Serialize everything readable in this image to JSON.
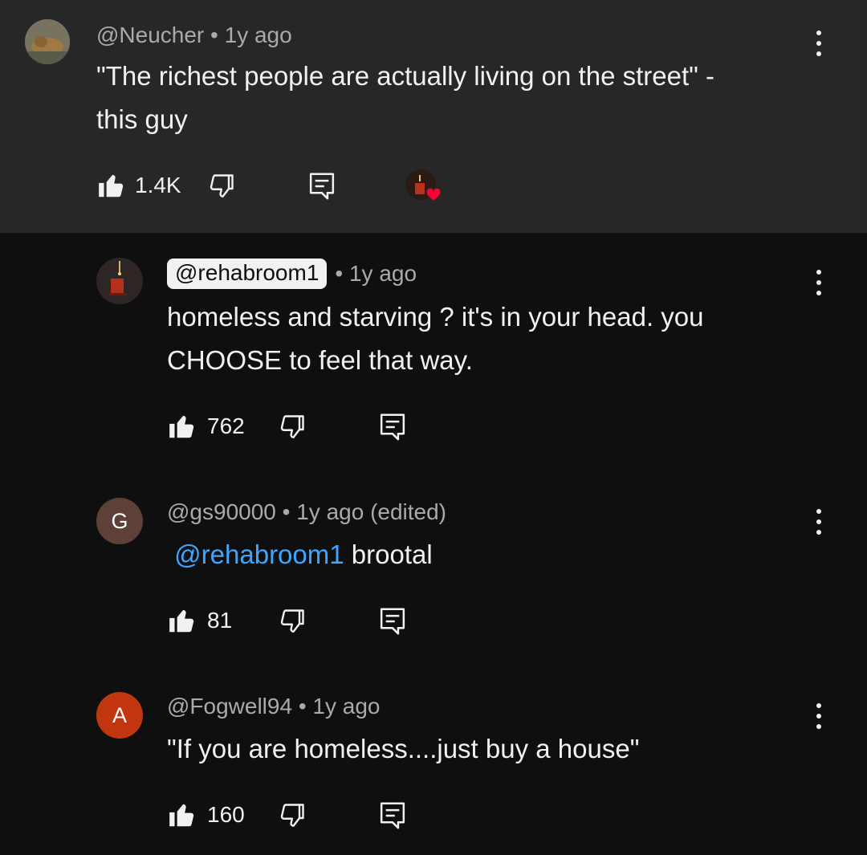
{
  "comments": [
    {
      "handle": "@Neucher",
      "meta": " • 1y ago",
      "text_line1": "\"The richest people are actually living on the street\" -",
      "text_line2": "this guy",
      "likes": "1.4K",
      "creator_hearted": true
    },
    {
      "handle": "@rehabroom1",
      "meta": "• 1y ago",
      "text_line1": "homeless and starving ? it's in your head. you",
      "text_line2": "CHOOSE to feel that way.",
      "likes": "762",
      "handle_highlighted": true
    },
    {
      "handle": "@gs90000",
      "meta": " • 1y ago (edited)",
      "avatar_letter": "G",
      "avatar_color": "#5d4037",
      "mention": "@rehabroom1",
      "text_line1": " brootal",
      "likes": "81"
    },
    {
      "handle": "@Fogwell94",
      "meta": " • 1y ago",
      "avatar_letter": "A",
      "avatar_color": "#c1360f",
      "text_line1": "\"If you are homeless....just buy a house\"",
      "likes": "160"
    }
  ],
  "colors": {
    "background": "#0f0f0f",
    "highlight_background": "#272727",
    "mention": "#3ea6ff",
    "heart": "#ff0033"
  },
  "icons": [
    "like-icon",
    "dislike-icon",
    "reply-icon",
    "more-vert-icon",
    "heart-icon"
  ]
}
